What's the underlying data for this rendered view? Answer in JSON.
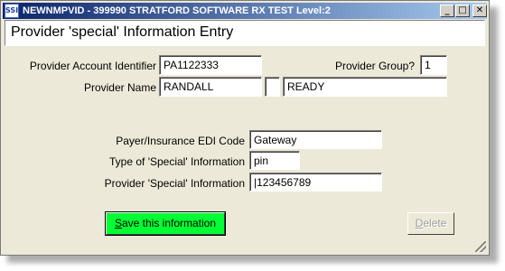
{
  "window": {
    "icon_text": "SSI",
    "title": "NEWNMPVID - 399990 STRATFORD SOFTWARE RX TEST Level:2",
    "minimize_glyph": "_",
    "maximize_glyph": "□",
    "close_glyph": "✕"
  },
  "header": {
    "title": "Provider 'special' Information Entry"
  },
  "form": {
    "provider_account_identifier": {
      "label": "Provider Account Identifier",
      "value": "PA1122333"
    },
    "provider_group": {
      "label": "Provider Group?",
      "value": "1"
    },
    "provider_name": {
      "label": "Provider Name",
      "last_name": "RANDALL",
      "middle_initial": "",
      "first_name": "READY"
    },
    "payer_edi_code": {
      "label": "Payer/Insurance EDI Code",
      "value": "Gateway"
    },
    "special_info_type": {
      "label": "Type of 'Special' Information",
      "value": "pin"
    },
    "special_info": {
      "label": "Provider 'Special' Information",
      "value": "|123456789"
    }
  },
  "buttons": {
    "save_prefix": "S",
    "save_rest": "ave this information",
    "delete_prefix": "D",
    "delete_rest": "elete"
  }
}
